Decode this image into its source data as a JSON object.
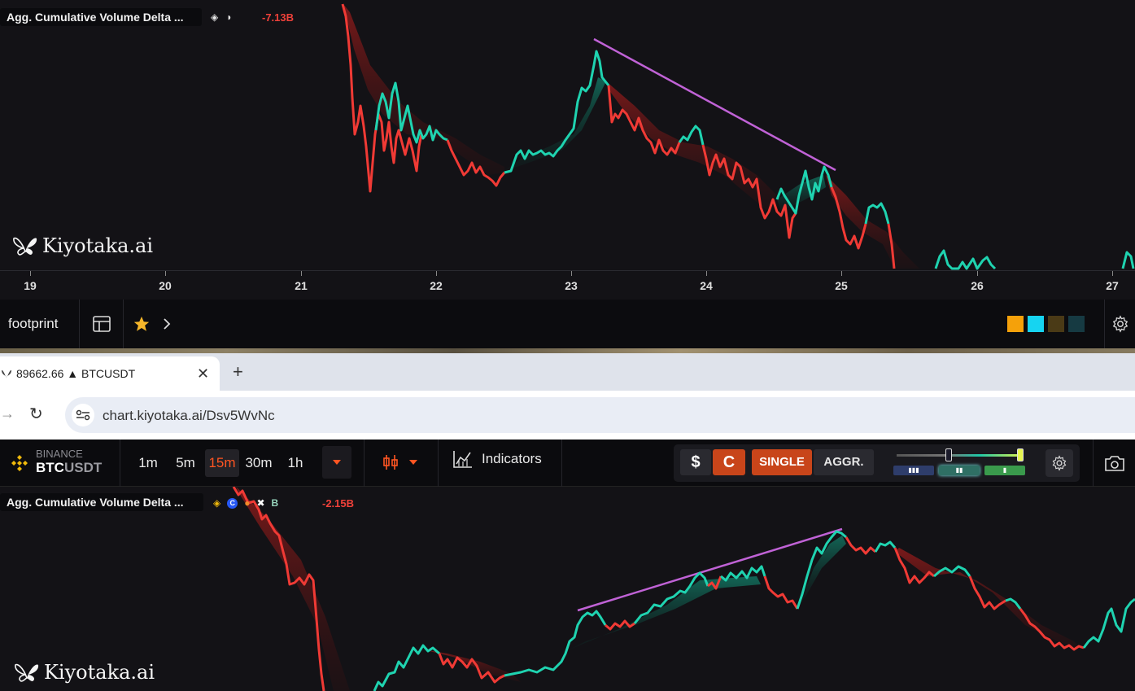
{
  "top_chart": {
    "indicator_title": "Agg. Cumulative Volume Delta ...",
    "delta_value": "-7.13B",
    "x_ticks": [
      "19",
      "20",
      "21",
      "22",
      "23",
      "24",
      "25",
      "26",
      "27"
    ],
    "logo_text": "Kiyotaka.ai"
  },
  "top_toolbar": {
    "footprint_label": "footprint",
    "swatch_colors": [
      "#f5a10a",
      "#16d4f1",
      "#4a3a16",
      "#163a42"
    ]
  },
  "browser": {
    "tab_title": "89662.66 ▲ BTCUSDT",
    "new_tab_label": "+",
    "close_label": "✕",
    "url": "chart.kiyotaka.ai/Dsv5WvNc"
  },
  "header": {
    "exchange": "BINANCE",
    "symbol_base": "BTC",
    "symbol_quote": "USDT",
    "timeframes": [
      "1m",
      "5m",
      "15m",
      "30m",
      "1h"
    ],
    "active_timeframe": "15m",
    "indicators_label": "Indicators",
    "currency_dollar": "$",
    "currency_coin": "C",
    "single_label": "SINGLE",
    "aggr_label": "AGGR."
  },
  "bottom_chart": {
    "indicator_title": "Agg. Cumulative Volume Delta ...",
    "delta_value": "-2.15B",
    "logo_text": "Kiyotaka.ai"
  },
  "colors": {
    "up": "#1fd3b0",
    "down": "#f03a35",
    "trendline": "#c062d6",
    "accent": "#ff5522",
    "background": "#131216"
  }
}
